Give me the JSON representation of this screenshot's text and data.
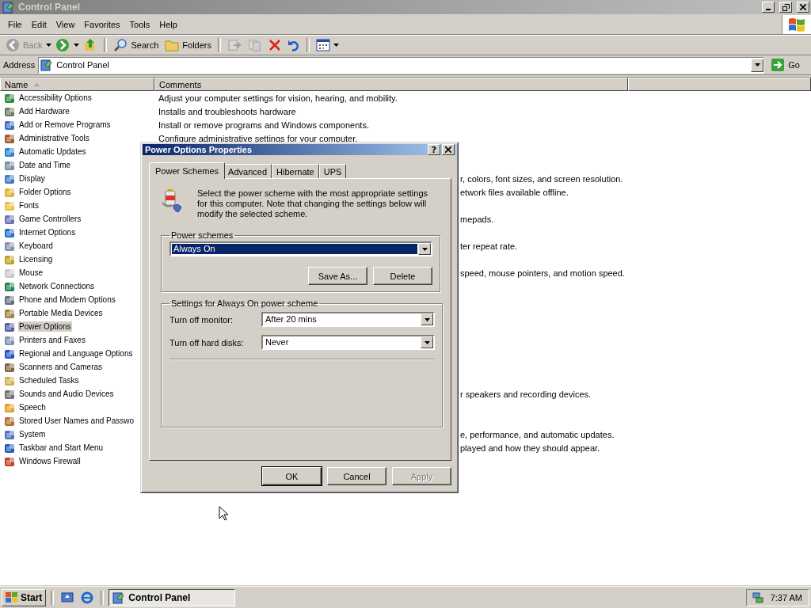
{
  "window": {
    "title": "Control Panel",
    "active": false
  },
  "menu": [
    "File",
    "Edit",
    "View",
    "Favorites",
    "Tools",
    "Help"
  ],
  "toolbar": {
    "back": {
      "label": "Back",
      "disabled": true
    },
    "search": "Search",
    "folders": "Folders"
  },
  "address": {
    "label": "Address",
    "value": "Control Panel",
    "go": "Go"
  },
  "columns": [
    "Name",
    "Comments"
  ],
  "rows": [
    {
      "name": "Accessibility Options",
      "selected": false,
      "comment": "Adjust your computer settings for vision, hearing, and mobility."
    },
    {
      "name": "Add Hardware",
      "selected": false,
      "comment": "Installs and troubleshoots hardware"
    },
    {
      "name": "Add or Remove Programs",
      "selected": false,
      "comment": "Install or remove programs and Windows components."
    },
    {
      "name": "Administrative Tools",
      "selected": false,
      "comment": "Configure administrative settings for your computer."
    },
    {
      "name": "Automatic Updates",
      "selected": false
    },
    {
      "name": "Date and Time",
      "selected": false
    },
    {
      "name": "Display",
      "selected": false,
      "comment_tail": "r, colors, font sizes, and screen resolution."
    },
    {
      "name": "Folder Options",
      "selected": false,
      "comment_tail": "etwork files available offline."
    },
    {
      "name": "Fonts",
      "selected": false
    },
    {
      "name": "Game Controllers",
      "selected": false,
      "comment_tail": "mepads."
    },
    {
      "name": "Internet Options",
      "selected": false
    },
    {
      "name": "Keyboard",
      "selected": false,
      "comment_tail": "ter repeat rate."
    },
    {
      "name": "Licensing",
      "selected": false
    },
    {
      "name": "Mouse",
      "selected": false,
      "comment_tail": "speed, mouse pointers, and motion speed."
    },
    {
      "name": "Network Connections",
      "selected": false
    },
    {
      "name": "Phone and Modem Options",
      "selected": false
    },
    {
      "name": "Portable Media Devices",
      "selected": false
    },
    {
      "name": "Power Options",
      "selected": true
    },
    {
      "name": "Printers and Faxes",
      "selected": false
    },
    {
      "name": "Regional and Language Options",
      "selected": false
    },
    {
      "name": "Scanners and Cameras",
      "selected": false
    },
    {
      "name": "Scheduled Tasks",
      "selected": false
    },
    {
      "name": "Sounds and Audio Devices",
      "selected": false,
      "comment_tail": "r speakers and recording devices."
    },
    {
      "name": "Speech",
      "selected": false
    },
    {
      "name": "Stored User Names and Passwo",
      "selected": false
    },
    {
      "name": "System",
      "selected": false,
      "comment_tail": "e, performance, and automatic updates."
    },
    {
      "name": "Taskbar and Start Menu",
      "selected": false,
      "comment_tail": "played and how they should appear."
    },
    {
      "name": "Windows Firewall",
      "selected": false
    }
  ],
  "dialog": {
    "title": "Power Options Properties",
    "help": "?",
    "tabs": [
      {
        "label": "Power Schemes",
        "selected": true
      },
      {
        "label": "Advanced",
        "selected": false
      },
      {
        "label": "Hibernate",
        "selected": false
      },
      {
        "label": "UPS",
        "selected": false
      }
    ],
    "description": "Select the power scheme with the most appropriate settings for this computer. Note that changing the settings below will modify the selected scheme.",
    "schemes_group": {
      "title": "Power schemes",
      "value": "Always On",
      "focused": true,
      "buttons": [
        "Save As...",
        "Delete"
      ]
    },
    "settings_group": {
      "title": "Settings for Always On power scheme",
      "settings": [
        {
          "label": "Turn off monitor:",
          "value": "After 20 mins"
        },
        {
          "label": "Turn off hard disks:",
          "value": "Never"
        }
      ]
    },
    "buttons": [
      {
        "label": "OK",
        "disabled": false
      },
      {
        "label": "Cancel",
        "disabled": false
      },
      {
        "label": "Apply",
        "disabled": true
      }
    ]
  },
  "taskbar": {
    "start": "Start",
    "tasks": [
      {
        "label": "Control Panel",
        "selected": true
      }
    ],
    "clock": "7:37 AM"
  }
}
